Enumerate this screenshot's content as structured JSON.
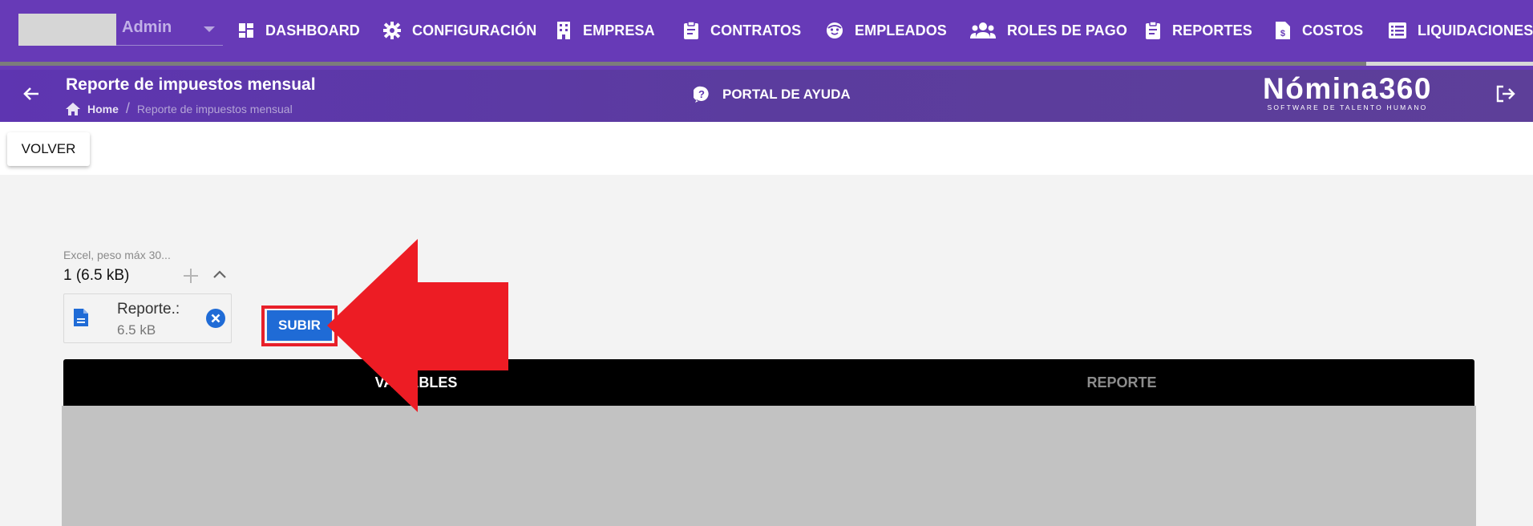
{
  "user": {
    "name": "Admin"
  },
  "nav": {
    "items": [
      {
        "label": "DASHBOARD",
        "icon": "dashboard-icon"
      },
      {
        "label": "CONFIGURACIÓN",
        "icon": "gear-icon"
      },
      {
        "label": "EMPRESA",
        "icon": "building-icon"
      },
      {
        "label": "CONTRATOS",
        "icon": "clipboard-icon"
      },
      {
        "label": "EMPLEADOS",
        "icon": "face-icon"
      },
      {
        "label": "ROLES DE PAGO",
        "icon": "people-icon"
      },
      {
        "label": "REPORTES",
        "icon": "clipboard-icon"
      },
      {
        "label": "COSTOS",
        "icon": "dollar-file-icon"
      },
      {
        "label": "LIQUIDACIONES",
        "icon": "list-icon"
      }
    ]
  },
  "header": {
    "title": "Reporte de impuestos mensual",
    "breadcrumb": {
      "home": "Home",
      "separator": "/",
      "current": "Reporte de impuestos mensual"
    },
    "help_label": "PORTAL DE AYUDA",
    "brand_name": "Nómina360",
    "brand_tagline": "SOFTWARE DE TALENTO HUMANO"
  },
  "toolbar": {
    "back_label": "VOLVER"
  },
  "upload": {
    "hint": "Excel, peso máx 30...",
    "count": "1 (6.5 kB)",
    "file": {
      "name": "Reporte.:",
      "size": "6.5 kB"
    },
    "submit_label": "SUBIR"
  },
  "tabs": [
    {
      "label": "VARIABLES"
    },
    {
      "label": "REPORTE"
    }
  ],
  "colors": {
    "nav_bg": "#673ab7",
    "header_bg": "#5e35b1",
    "accent_blue": "#1f6bd6",
    "annotation_red": "#ed1c24"
  }
}
